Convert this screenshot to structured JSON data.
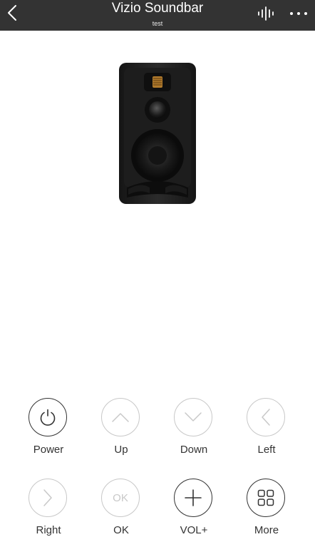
{
  "header": {
    "title": "Vizio Soundbar",
    "subtitle": "test"
  },
  "icons": {
    "back": "chevron-left-icon",
    "voice": "sound-wave-icon",
    "menu": "more-dots-icon",
    "device": "speaker-image"
  },
  "colors": {
    "topbar": "#333333",
    "active_icon": "#333333",
    "disabled_icon": "#c8c8c8",
    "background": "#ffffff"
  },
  "buttons": [
    {
      "label": "Power",
      "icon": "power-icon",
      "enabled": true
    },
    {
      "label": "Up",
      "icon": "chevron-up-icon",
      "enabled": false
    },
    {
      "label": "Down",
      "icon": "chevron-down-icon",
      "enabled": false
    },
    {
      "label": "Left",
      "icon": "chevron-left-icon",
      "enabled": false
    },
    {
      "label": "Right",
      "icon": "chevron-right-icon",
      "enabled": false
    },
    {
      "label": "OK",
      "icon_text": "OK",
      "enabled": false
    },
    {
      "label": "VOL+",
      "icon": "plus-icon",
      "enabled": true
    },
    {
      "label": "More",
      "icon": "grid-icon",
      "enabled": true
    }
  ]
}
